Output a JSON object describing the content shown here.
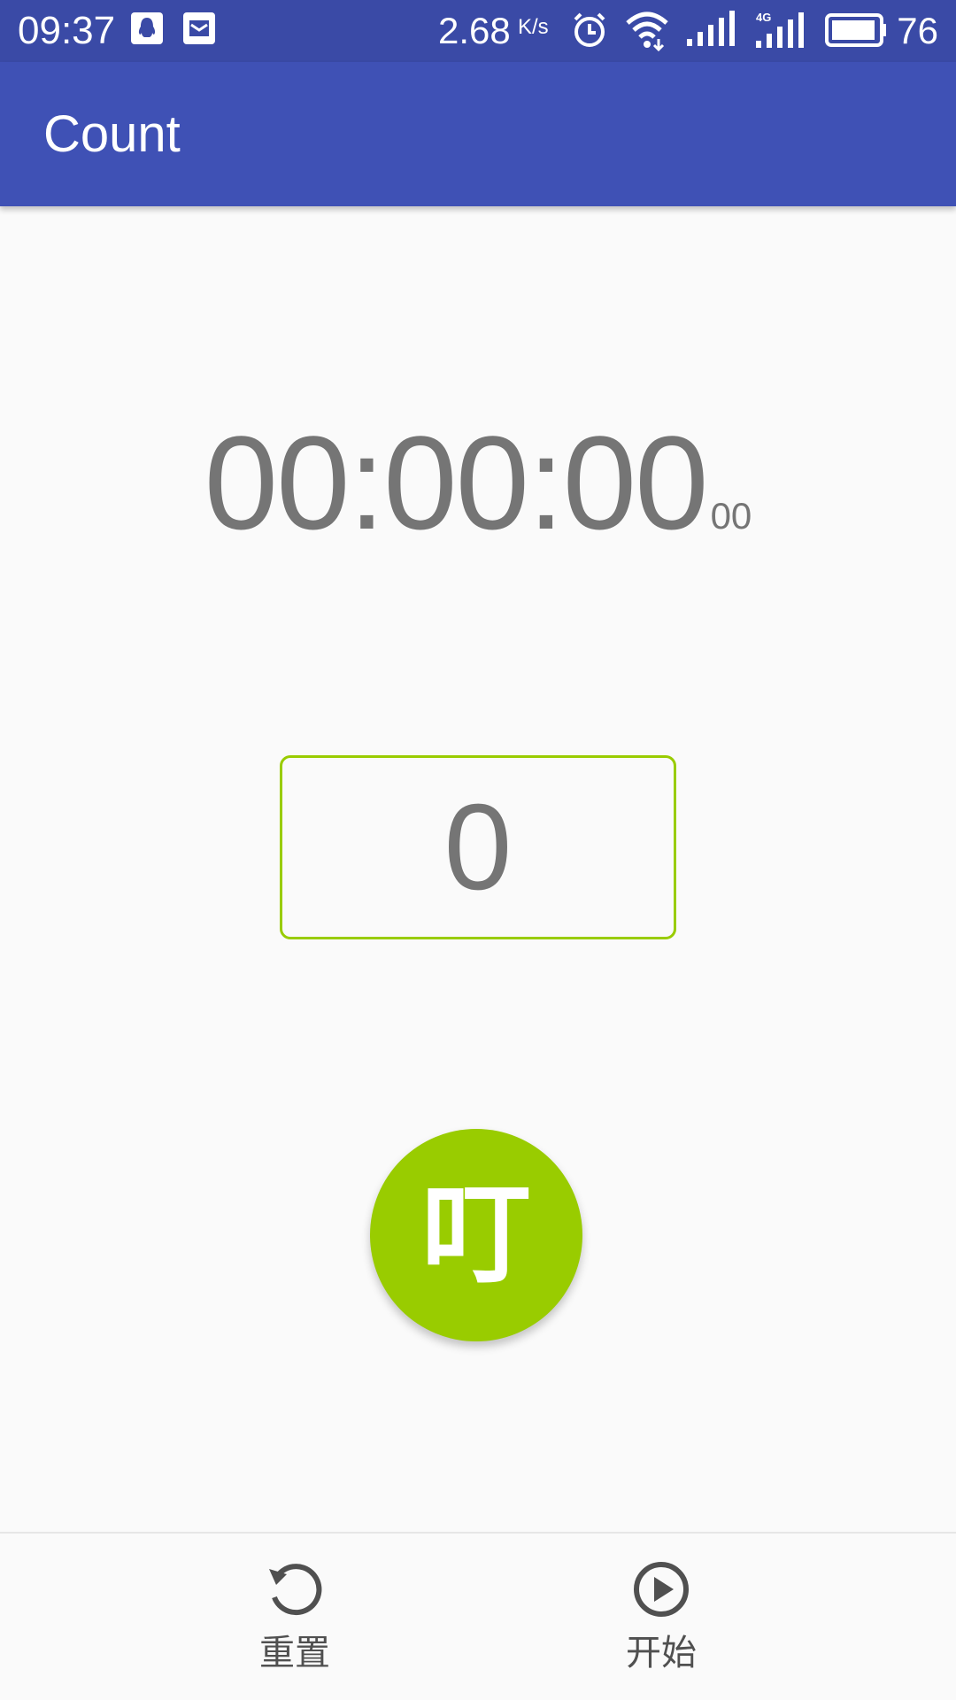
{
  "status_bar": {
    "time": "09:37",
    "net_speed": "2.68",
    "net_speed_unit": "K/s",
    "battery": "76",
    "icons": [
      "qq-icon",
      "mail-icon",
      "alarm-icon",
      "wifi-icon",
      "signal-icon",
      "signal-4g-icon",
      "battery-icon"
    ]
  },
  "app_bar": {
    "title": "Count"
  },
  "timer": {
    "main": "00:00:00",
    "ms": "00"
  },
  "counter": {
    "value": "0"
  },
  "ding_button": {
    "label": "叮"
  },
  "bottom_bar": {
    "reset_label": "重置",
    "start_label": "开始"
  },
  "colors": {
    "status_bar": "#3a4aa6",
    "app_bar": "#3f51b5",
    "accent": "#99cc00",
    "timer_text": "#757575",
    "background": "#fafafa"
  }
}
